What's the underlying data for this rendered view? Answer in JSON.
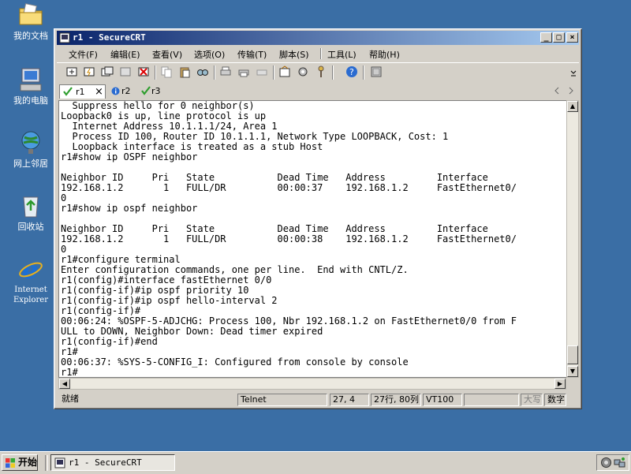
{
  "desktop": {
    "icons": [
      {
        "label": "我的文档",
        "icon": "folder-icon"
      },
      {
        "label": "我的电脑",
        "icon": "computer-icon"
      },
      {
        "label": "网上邻居",
        "icon": "network-icon"
      },
      {
        "label": "回收站",
        "icon": "recycle-bin-icon"
      },
      {
        "label": "Internet\nExplorer",
        "icon": "ie-icon"
      }
    ]
  },
  "window": {
    "title": "r1 - SecureCRT",
    "buttons": {
      "minimize": "_",
      "maximize": "□",
      "close": "×"
    }
  },
  "menu": [
    {
      "label": "文件(F)"
    },
    {
      "label": "编辑(E)"
    },
    {
      "label": "查看(V)"
    },
    {
      "label": "选项(O)"
    },
    {
      "label": "传输(T)"
    },
    {
      "label": "脚本(S)"
    },
    {
      "label": "工具(L)"
    },
    {
      "label": "帮助(H)"
    }
  ],
  "tabs": [
    {
      "label": "r1",
      "status": "connected",
      "close": "×"
    },
    {
      "label": "r2",
      "status": "info"
    },
    {
      "label": "r3",
      "status": "connected"
    }
  ],
  "terminal": {
    "lines": [
      "  Suppress hello for 0 neighbor(s)",
      "Loopback0 is up, line protocol is up",
      "  Internet Address 10.1.1.1/24, Area 1",
      "  Process ID 100, Router ID 10.1.1.1, Network Type LOOPBACK, Cost: 1",
      "  Loopback interface is treated as a stub Host",
      "r1#show ip OSPF neighbor",
      "",
      "Neighbor ID     Pri   State           Dead Time   Address         Interface",
      "192.168.1.2       1   FULL/DR         00:00:37    192.168.1.2     FastEthernet0/",
      "0",
      "r1#show ip ospf neighbor",
      "",
      "Neighbor ID     Pri   State           Dead Time   Address         Interface",
      "192.168.1.2       1   FULL/DR         00:00:38    192.168.1.2     FastEthernet0/",
      "0",
      "r1#configure terminal",
      "Enter configuration commands, one per line.  End with CNTL/Z.",
      "r1(config)#interface fastEthernet 0/0",
      "r1(config-if)#ip ospf priority 10",
      "r1(config-if)#ip ospf hello-interval 2",
      "r1(config-if)#",
      "00:06:24: %OSPF-5-ADJCHG: Process 100, Nbr 192.168.1.2 on FastEthernet0/0 from F",
      "ULL to DOWN, Neighbor Down: Dead timer expired",
      "r1(config-if)#end",
      "r1#",
      "00:06:37: %SYS-5-CONFIG_I: Configured from console by console",
      "r1#"
    ]
  },
  "status": {
    "ready": "就绪",
    "protocol": "Telnet",
    "cursor": "27,  4",
    "size": "27行, 80列",
    "emulation": "VT100",
    "caps": "大写",
    "num": "数字"
  },
  "taskbar": {
    "start": "开始",
    "task": "r1 - SecureCRT"
  },
  "colors": {
    "desktop": "#3a6ea5",
    "title_start": "#0a246a",
    "title_end": "#a6caf0",
    "check_green": "#2e9e2e"
  }
}
